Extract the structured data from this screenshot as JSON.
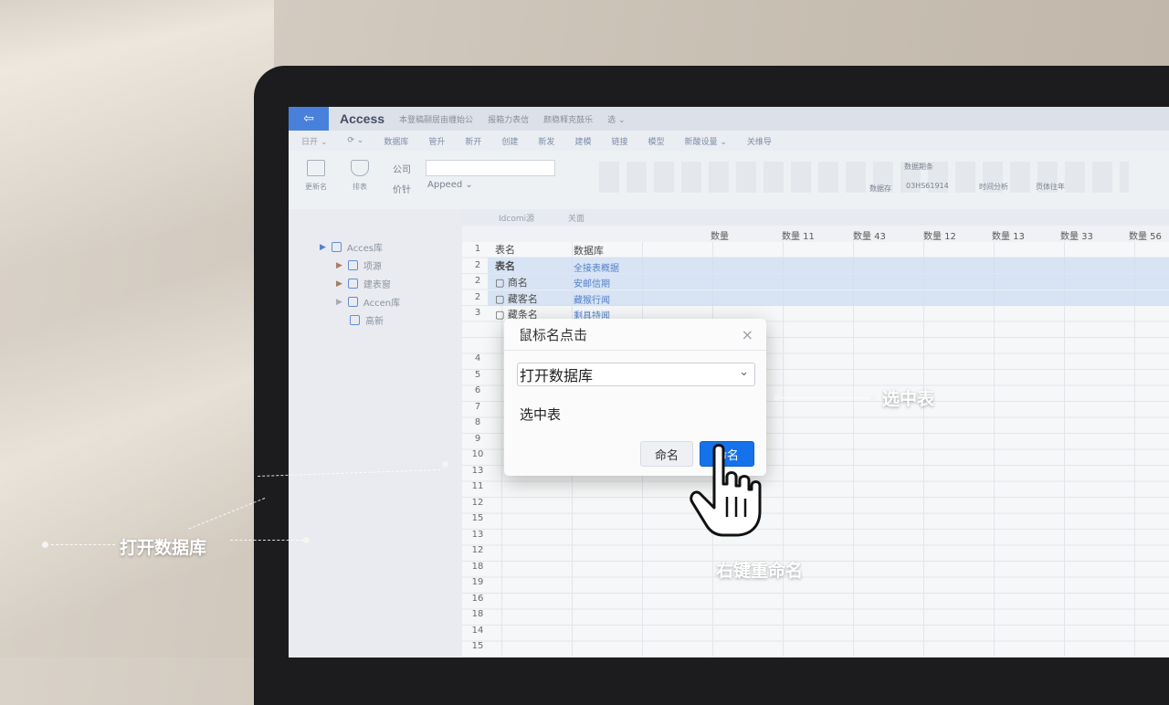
{
  "app": {
    "back_glyph": "⇦",
    "name": "Access",
    "doc_tabs": [
      "本登稿翮居亩缠始公",
      "报箱力表信",
      "颜稳释克鼓乐",
      "选 ⌄"
    ]
  },
  "menubar": {
    "items": [
      "日开 ⌄",
      "⟳ ⌄",
      "数据库",
      "管升",
      "新开",
      "创建",
      "新发",
      "建模",
      "链接",
      "模型",
      "新酸设量 ⌄",
      "关维导"
    ]
  },
  "ribbon": {
    "items": [
      "更新名",
      "排表"
    ],
    "field_label": "公司",
    "field_label2": "价针",
    "field_value": "Appeed ⌄",
    "right_label": "数据期条",
    "right_value": "03HS61914",
    "right_btn1": "数据存",
    "right_btn2": "时间分析",
    "right_btn3": "页体往年"
  },
  "sidebar": {
    "items": [
      "Acces库",
      "项源",
      "建表窗",
      "Accen库",
      "高新"
    ]
  },
  "grid": {
    "sheet_tabs": [
      "Idcomi源",
      "关面"
    ],
    "columns": [
      "表名",
      "数据库",
      "数量",
      "数量 11",
      "数量 43",
      "数量 12",
      "数量 13",
      "数量 33",
      "数量 56"
    ],
    "rows": [
      {
        "n": "1",
        "a": "表名",
        "b": "数据库"
      },
      {
        "n": "2",
        "a": "表名",
        "b": "全接表概据"
      },
      {
        "n": "2",
        "a": "▢ 商名",
        "b": "安邮信期"
      },
      {
        "n": "2",
        "a": "▢ 藏客名",
        "b": "藏猴行闻"
      },
      {
        "n": "3",
        "a": "▢ 藏条名",
        "b": "剩具持闻"
      }
    ],
    "row_numbers": [
      "4",
      "5",
      "6",
      "7",
      "8",
      "9",
      "10",
      "13",
      "11",
      "12",
      "15",
      "13",
      "12",
      "18",
      "19",
      "16",
      "18",
      "14",
      "15"
    ]
  },
  "dialog": {
    "title": "鼠标名点击",
    "close_glyph": "×",
    "select_value": "打开数据库",
    "select_chevron": "⌄",
    "text": "选中表",
    "secondary_button": "命名",
    "primary_button": "命名"
  },
  "callouts": {
    "select_table": "选中表",
    "open_db": "打开数据库",
    "rename": "右键重命名"
  }
}
